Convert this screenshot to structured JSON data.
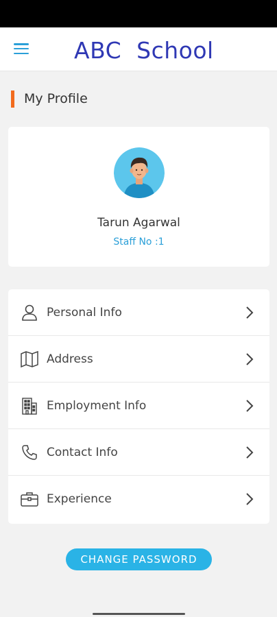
{
  "header": {
    "title": "ABC  School",
    "menu_icon": "hamburger-menu-icon"
  },
  "section": {
    "title": "My Profile",
    "accent_color": "#f26b1d"
  },
  "profile": {
    "name": "Tarun Agarwal",
    "staff_no": "Staff No :1",
    "avatar_icon": "user-avatar"
  },
  "menu": {
    "items": [
      {
        "label": "Personal Info",
        "icon": "person-icon"
      },
      {
        "label": "Address",
        "icon": "map-icon"
      },
      {
        "label": "Employment Info",
        "icon": "building-icon"
      },
      {
        "label": "Contact Info",
        "icon": "phone-icon"
      },
      {
        "label": "Experience",
        "icon": "briefcase-icon"
      }
    ]
  },
  "actions": {
    "change_password_label": "CHANGE PASSWORD"
  },
  "colors": {
    "title": "#2f38b4",
    "accent_blue": "#2ab3e6",
    "orange": "#f26b1d"
  }
}
